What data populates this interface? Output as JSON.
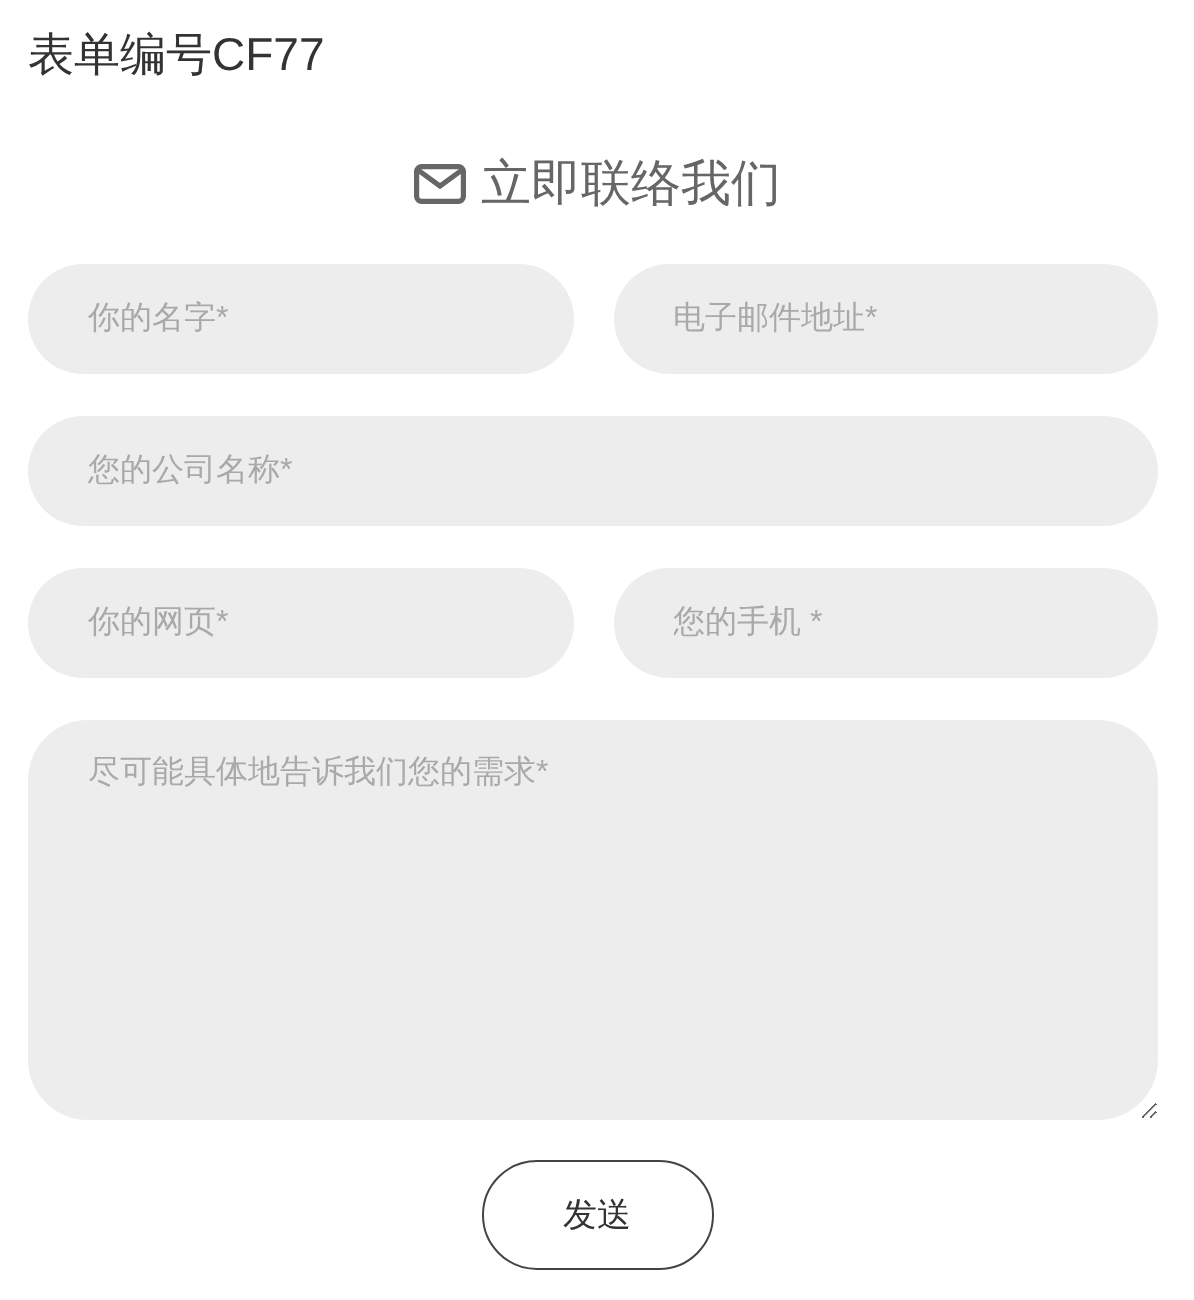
{
  "form_title": "表单编号CF77",
  "heading": {
    "text": "立即联络我们"
  },
  "rows": [
    [
      {
        "kind": "input",
        "placeholder": "你的名字*"
      },
      {
        "kind": "input",
        "placeholder": "电子邮件地址*"
      }
    ],
    [
      {
        "kind": "input",
        "placeholder": "您的公司名称*"
      }
    ],
    [
      {
        "kind": "input",
        "placeholder": "你的网页*"
      },
      {
        "kind": "input",
        "placeholder": "您的手机 *"
      }
    ],
    [
      {
        "kind": "textarea",
        "placeholder": "尽可能具体地告诉我们您的需求*"
      }
    ]
  ],
  "submit_button": "发送"
}
